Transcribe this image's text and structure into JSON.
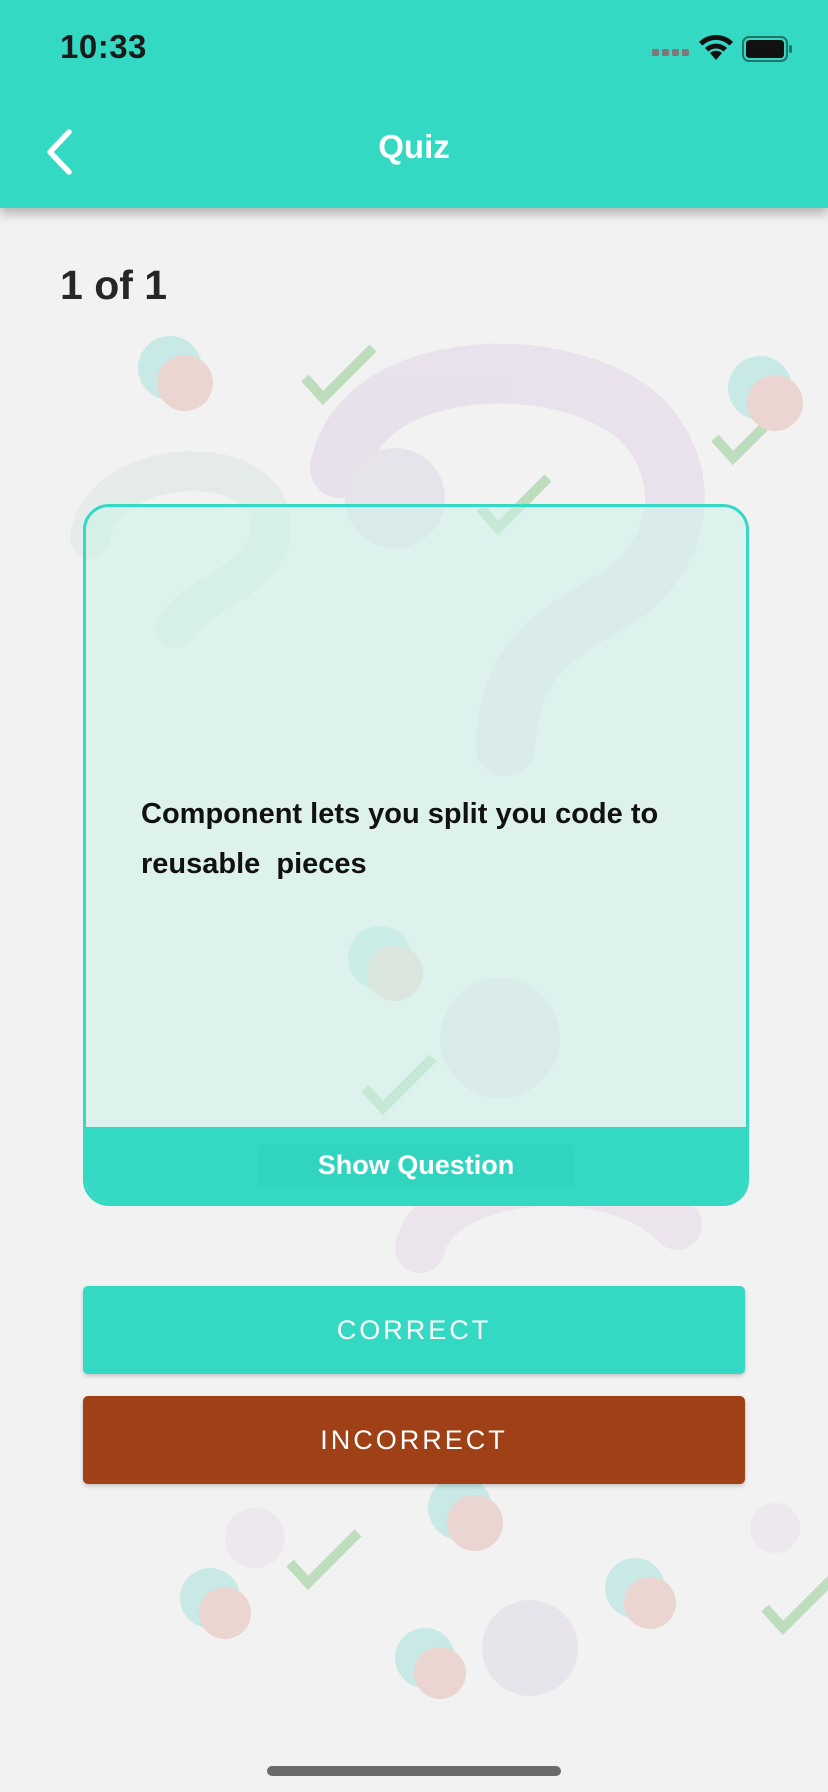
{
  "status_bar": {
    "time": "10:33"
  },
  "header": {
    "title": "Quiz"
  },
  "quiz": {
    "counter": "1 of 1",
    "card_text": "Component lets you split you code to reusable  pieces",
    "show_question_label": "Show Question"
  },
  "actions": {
    "correct_label": "CORRECT",
    "incorrect_label": "INCORRECT"
  },
  "colors": {
    "accent": "#34d9c3",
    "incorrect": "#a04016",
    "background": "#f2f2f2"
  }
}
